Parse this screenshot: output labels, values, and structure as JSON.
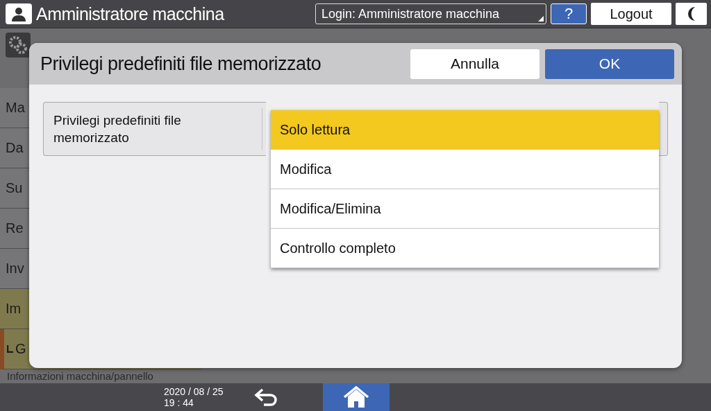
{
  "top_bar": {
    "title": "Amministratore macchina",
    "login": "Login: Amministratore macchina",
    "help": "?",
    "logout": "Logout"
  },
  "sidebar": {
    "items": [
      {
        "label": "Ma",
        "selected": false,
        "kind": "item"
      },
      {
        "label": "Da",
        "selected": false,
        "kind": "item"
      },
      {
        "label": "Su",
        "selected": false,
        "kind": "item"
      },
      {
        "label": "Re",
        "selected": false,
        "kind": "item"
      },
      {
        "label": "Inv",
        "selected": false,
        "kind": "item"
      },
      {
        "label": "Im",
        "selected": true,
        "kind": "item"
      },
      {
        "label": "G",
        "selected": true,
        "kind": "sub"
      }
    ],
    "footer": "Informazioni macchina/pannello"
  },
  "dialog": {
    "title": "Privilegi predefiniti file memorizzato",
    "cancel": "Annulla",
    "ok": "OK",
    "setting": {
      "label": "Privilegi predefiniti file memorizzato",
      "options": [
        {
          "label": "Solo lettura",
          "selected": true
        },
        {
          "label": "Modifica",
          "selected": false
        },
        {
          "label": "Modifica/Elimina",
          "selected": false
        },
        {
          "label": "Controllo completo",
          "selected": false
        }
      ]
    }
  },
  "bottom_bar": {
    "date": "2020 / 08 / 25",
    "time": "19 : 44"
  }
}
